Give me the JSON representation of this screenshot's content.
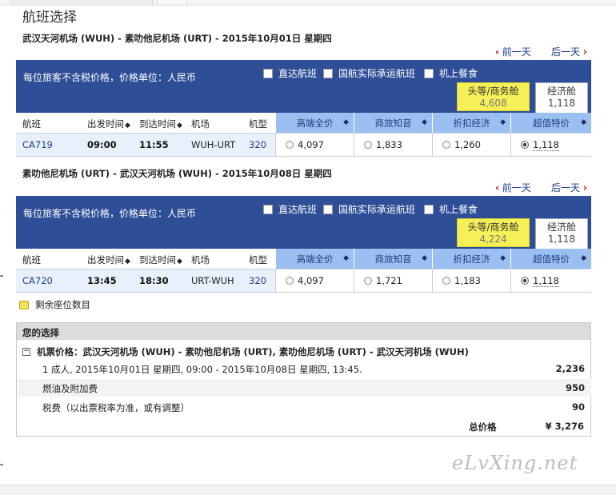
{
  "page_title": "航班选择",
  "filters": {
    "note": "每位旅客不含税价格，价格单位：人民币",
    "direct": "直达航班",
    "air_china_operated": "国航实际承运航班",
    "meal": "机上餐食"
  },
  "nav": {
    "prev": "前一天",
    "next": "后一天",
    "prev_arrow": "‹",
    "next_arrow": "›"
  },
  "columns": {
    "flight": "航班",
    "depart": "出发时间",
    "arrive": "到达时间",
    "airport": "机场",
    "aircraft": "机型",
    "fares": [
      "高端全价",
      "商旅知音",
      "折扣经济",
      "超值特价"
    ],
    "sort_icon": "◆"
  },
  "outbound": {
    "route": "武汉天河机场 (WUH) - 素叻他尼机场 (URT) - 2015年10月01日 星期四",
    "cabin_first": {
      "label": "头等/商务舱",
      "price": "4,608"
    },
    "cabin_economy": {
      "label": "经济舱",
      "price": "1,118"
    },
    "flight": {
      "number": "CA719",
      "depart": "09:00",
      "arrive": "11:55",
      "airport": "WUH-URT",
      "aircraft": "320",
      "fares": [
        "4,097",
        "1,833",
        "1,260",
        "1,118"
      ],
      "selected_fare_index": 3
    }
  },
  "inbound": {
    "route": "素叻他尼机场 (URT) - 武汉天河机场 (WUH) - 2015年10月08日 星期四",
    "cabin_first": {
      "label": "头等/商务舱",
      "price": "4,224"
    },
    "cabin_economy": {
      "label": "经济舱",
      "price": "1,118"
    },
    "flight": {
      "number": "CA720",
      "depart": "13:45",
      "arrive": "18:30",
      "airport": "URT-WUH",
      "aircraft": "320",
      "fares": [
        "4,097",
        "1,721",
        "1,183",
        "1,118"
      ],
      "selected_fare_index": 3
    }
  },
  "legend": "剩余座位数目",
  "selection": {
    "title": "您的选择",
    "fare_summary": "机票价格：武汉天河机场 (WUH) - 素叻他尼机场 (URT), 素叻他尼机场 (URT) - 武汉天河机场 (WUH)",
    "rows": [
      {
        "label": "1 成人, 2015年10月01日 星期四, 09:00 - 2015年10月08日 星期四, 13:45.",
        "value": "2,236"
      },
      {
        "label": "燃油及附加费",
        "value": "950"
      },
      {
        "label": "税费（以出票税率为准，或有调整）",
        "value": "90"
      }
    ],
    "total_label": "总价格",
    "total_value": "¥ 3,276"
  },
  "watermark": "eLvXing.net",
  "colors": {
    "header_blue": "#2f4e98",
    "fare_header": "#9bbff0",
    "row_bg": "#e8f0fb",
    "cabin_yellow": "#f6f058",
    "nav_arrow": "#cc0000"
  }
}
